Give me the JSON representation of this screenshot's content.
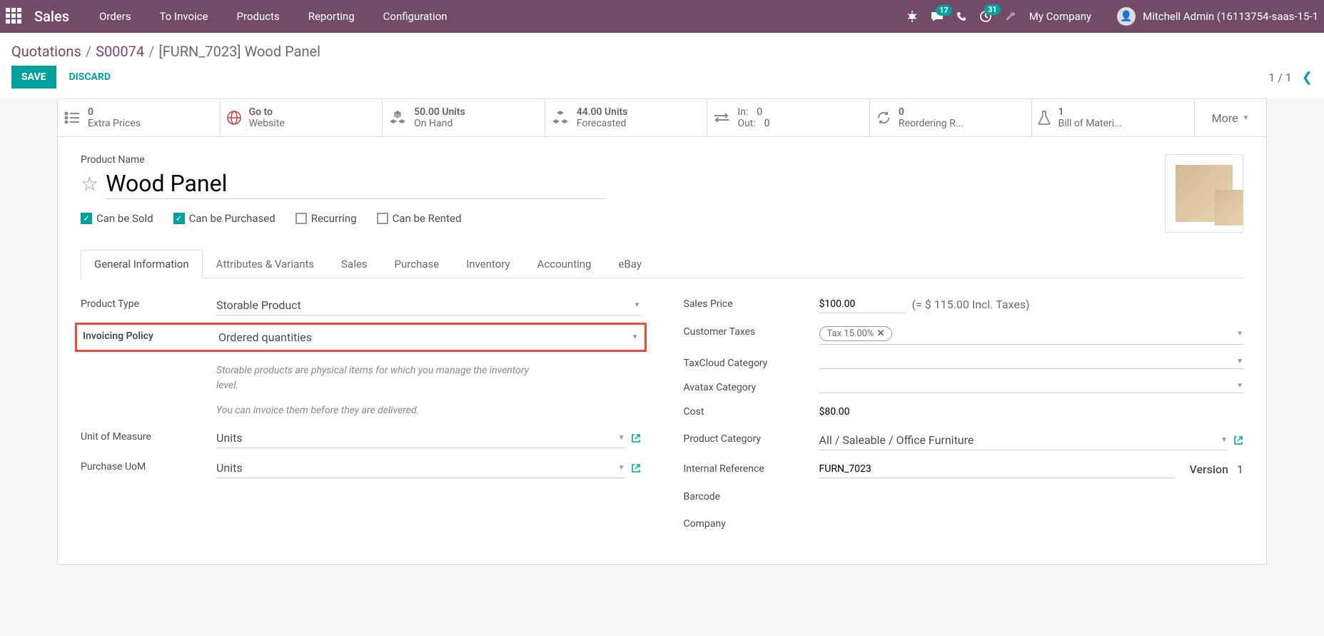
{
  "topbar": {
    "brand": "Sales",
    "menu": [
      "Orders",
      "To Invoice",
      "Products",
      "Reporting",
      "Configuration"
    ],
    "badges": {
      "messages": "17",
      "activities": "31"
    },
    "company": "My Company",
    "user": "Mitchell Admin (16113754-saas-15-1"
  },
  "breadcrumb": {
    "parts": [
      "Quotations",
      "S00074"
    ],
    "current": "[FURN_7023] Wood Panel"
  },
  "actions": {
    "save": "SAVE",
    "discard": "DISCARD"
  },
  "pager": {
    "text": "1 / 1"
  },
  "stats": [
    {
      "icon": "list",
      "value": "0",
      "label": "Extra Prices"
    },
    {
      "icon": "globe",
      "value": "Go to",
      "label": "Website"
    },
    {
      "icon": "cubes",
      "value": "50.00 Units",
      "label": "On Hand"
    },
    {
      "icon": "cubes",
      "value": "44.00 Units",
      "label": "Forecasted"
    },
    {
      "icon": "inout",
      "in_label": "In:",
      "in_val": "0",
      "out_label": "Out:",
      "out_val": "0"
    },
    {
      "icon": "refresh",
      "value": "0",
      "label": "Reordering R..."
    },
    {
      "icon": "flask",
      "value": "1",
      "label": "Bill of Materi..."
    }
  ],
  "more": "More",
  "product": {
    "name_label": "Product Name",
    "name": "Wood Panel",
    "checkboxes": [
      {
        "label": "Can be Sold",
        "checked": true
      },
      {
        "label": "Can be Purchased",
        "checked": true
      },
      {
        "label": "Recurring",
        "checked": false
      },
      {
        "label": "Can be Rented",
        "checked": false
      }
    ]
  },
  "tabs": [
    "General Information",
    "Attributes & Variants",
    "Sales",
    "Purchase",
    "Inventory",
    "Accounting",
    "eBay"
  ],
  "left_fields": {
    "product_type": {
      "label": "Product Type",
      "value": "Storable Product"
    },
    "invoicing_policy": {
      "label": "Invoicing Policy",
      "value": "Ordered quantities"
    },
    "help1": "Storable products are physical items for which you manage the inventory level.",
    "help2": "You can invoice them before they are delivered.",
    "uom": {
      "label": "Unit of Measure",
      "value": "Units"
    },
    "purchase_uom": {
      "label": "Purchase UoM",
      "value": "Units"
    }
  },
  "right_fields": {
    "sales_price": {
      "label": "Sales Price",
      "value": "$100.00",
      "note": "(= $ 115.00 Incl. Taxes)"
    },
    "customer_taxes": {
      "label": "Customer Taxes",
      "tag": "Tax 15.00%"
    },
    "taxcloud": {
      "label": "TaxCloud Category"
    },
    "avatax": {
      "label": "Avatax Category"
    },
    "cost": {
      "label": "Cost",
      "value": "$80.00"
    },
    "product_category": {
      "label": "Product Category",
      "value": "All / Saleable / Office Furniture"
    },
    "internal_ref": {
      "label": "Internal Reference",
      "value": "FURN_7023",
      "version_label": "Version",
      "version_value": "1"
    },
    "barcode": {
      "label": "Barcode"
    },
    "company": {
      "label": "Company"
    }
  }
}
